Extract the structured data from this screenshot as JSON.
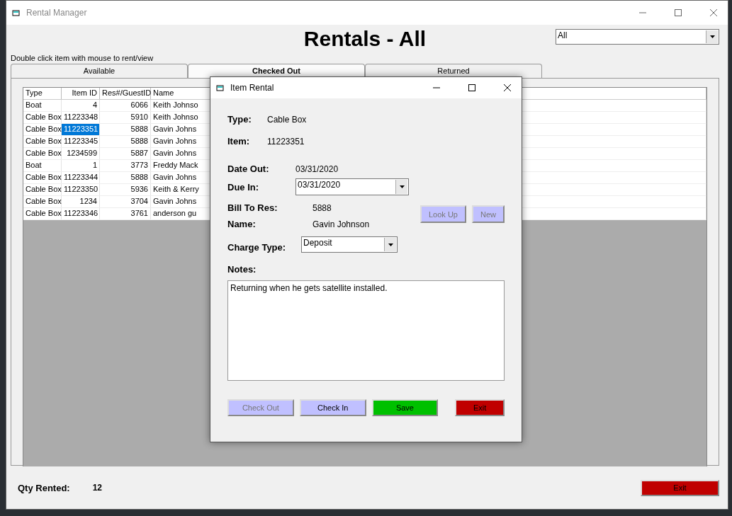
{
  "window": {
    "title": "Rental Manager"
  },
  "heading": "Rentals - All",
  "filter": {
    "value": "All"
  },
  "hint": "Double click item with mouse to rent/view",
  "tabs": [
    {
      "label": "Available",
      "selected": false
    },
    {
      "label": "Checked Out",
      "selected": true
    },
    {
      "label": "Returned",
      "selected": false
    }
  ],
  "table": {
    "columns": [
      "Type",
      "Item ID",
      "Res#/GuestID",
      "Name"
    ],
    "rows": [
      {
        "cells": [
          "Boat",
          "4",
          "6066",
          "Keith Johnso"
        ],
        "selected": false
      },
      {
        "cells": [
          "Cable Box",
          "11223348",
          "5910",
          "Keith Johnso"
        ],
        "selected": false
      },
      {
        "cells": [
          "Cable Box",
          "11223351",
          "5888",
          "Gavin Johns"
        ],
        "selected": true
      },
      {
        "cells": [
          "Cable Box",
          "11223345",
          "5888",
          "Gavin Johns"
        ],
        "selected": false
      },
      {
        "cells": [
          "Cable Box",
          "1234599",
          "5887",
          "Gavin Johns"
        ],
        "selected": false
      },
      {
        "cells": [
          "Boat",
          "1",
          "3773",
          "Freddy Mack"
        ],
        "selected": false
      },
      {
        "cells": [
          "Cable Box",
          "11223344",
          "5888",
          "Gavin Johns"
        ],
        "selected": false
      },
      {
        "cells": [
          "Cable Box",
          "11223350",
          "5936",
          "Keith & Kerry"
        ],
        "selected": false
      },
      {
        "cells": [
          "Cable Box",
          "1234",
          "3704",
          "Gavin Johns"
        ],
        "selected": false
      },
      {
        "cells": [
          "Cable Box",
          "11223346",
          "3761",
          "anderson gu"
        ],
        "selected": false
      }
    ]
  },
  "status": {
    "label": "Qty Rented:",
    "value": "12"
  },
  "exit_button": {
    "label": "Exit"
  },
  "dialog": {
    "title": "Item Rental",
    "type": {
      "label": "Type:",
      "value": "Cable Box"
    },
    "item": {
      "label": "Item:",
      "value": "11223351"
    },
    "date_out": {
      "label": "Date Out:",
      "value": "03/31/2020"
    },
    "due_in": {
      "label": "Due In:",
      "value": "03/31/2020"
    },
    "bill_to": {
      "label": "Bill To Res:",
      "value": "5888"
    },
    "name": {
      "label": "Name:",
      "value": "Gavin Johnson"
    },
    "side_buttons": [
      {
        "label": "Look Up",
        "disabled": true
      },
      {
        "label": "New",
        "disabled": true
      }
    ],
    "charge_type": {
      "label": "Charge Type:",
      "value": "Deposit"
    },
    "notes": {
      "label": "Notes:",
      "value": "Returning when he gets satellite installed."
    },
    "buttons": [
      {
        "label": "Check Out",
        "disabled": true,
        "color": "#c0c0ff"
      },
      {
        "label": "Check In",
        "disabled": false,
        "color": "#c0c0ff"
      },
      {
        "label": "Save",
        "disabled": false,
        "color": "#00c000"
      },
      {
        "label": "Exit",
        "disabled": false,
        "color": "#c00000"
      }
    ]
  }
}
